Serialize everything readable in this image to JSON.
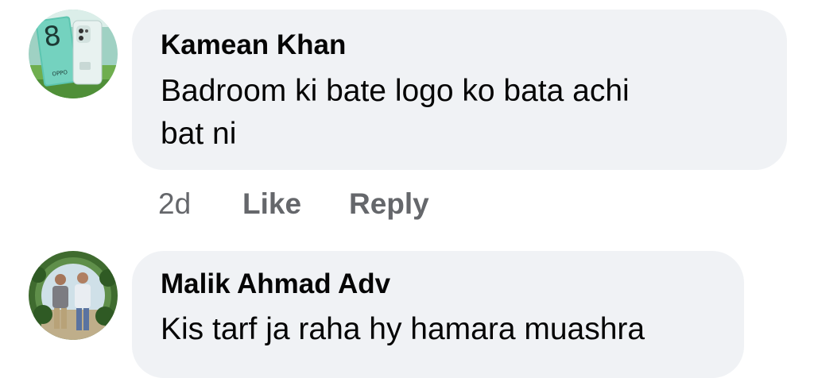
{
  "comments": [
    {
      "author": "Kamean Khan",
      "text_lines": [
        "Badroom ki bate logo ko bata achi",
        "bat ni"
      ],
      "time": "2d",
      "like_label": "Like",
      "reply_label": "Reply",
      "avatar_icon": "phone-box-photo-avatar",
      "avatar_text": "8"
    },
    {
      "author": "Malik Ahmad Adv",
      "text_lines": [
        "Kis tarf ja raha hy hamara muashra"
      ],
      "avatar_icon": "two-people-photo-avatar"
    }
  ],
  "colors": {
    "bubble_bg": "#f0f2f5",
    "text": "#050505",
    "meta": "#65676b"
  }
}
